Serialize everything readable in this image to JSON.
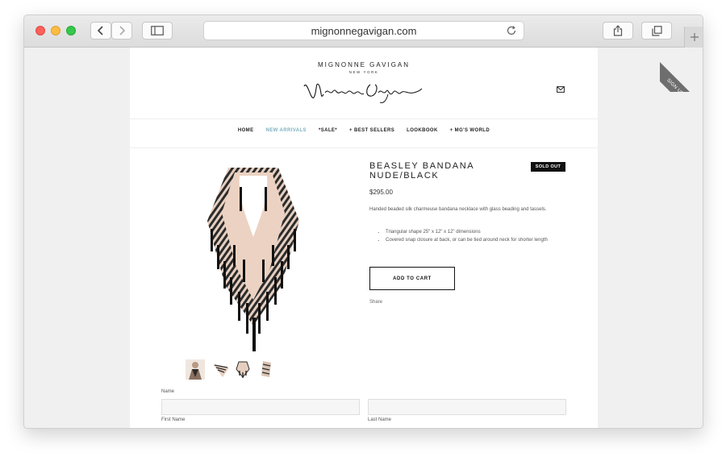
{
  "browser": {
    "url": "mignonnegavigan.com"
  },
  "site": {
    "brand": "MIGNONNE GAVIGAN",
    "location": "NEW YORK",
    "signup_ribbon": "SIGN UP!"
  },
  "nav": {
    "items": [
      {
        "label": "HOME",
        "active": false
      },
      {
        "label": "NEW ARRIVALS",
        "active": true
      },
      {
        "label": "*SALE*",
        "active": false
      },
      {
        "label": "+ BEST SELLERS",
        "active": false
      },
      {
        "label": "LOOKBOOK",
        "active": false
      },
      {
        "label": "+ MG'S WORLD",
        "active": false
      }
    ]
  },
  "product": {
    "title_line1": "BEASLEY BANDANA",
    "title_line2": "NUDE/BLACK",
    "badge": "SOLD OUT",
    "price": "$295.00",
    "description": "Handed beaded silk charmeuse bandana necklace with glass beading and tassels.",
    "bullets": [
      "Triangular shape 25\" x 12\" x 12\" dimensions",
      "Covered snap closure at back, or can be tied around neck for shorter length"
    ],
    "add_to_cart": "ADD TO CART",
    "share": "Share"
  },
  "form": {
    "name_label": "Name",
    "first_name_label": "First Name",
    "last_name_label": "Last Name"
  },
  "colors": {
    "nav_active": "#7bb0c0",
    "badge_bg": "#111111",
    "ribbon": "#6e6e6e"
  }
}
